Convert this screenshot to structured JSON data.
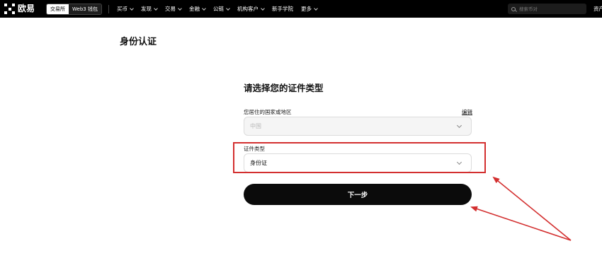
{
  "brand": {
    "name": "欧易"
  },
  "header": {
    "segments": [
      "交易所",
      "Web3 钱包"
    ],
    "nav": [
      {
        "label": "买币",
        "dropdown": true
      },
      {
        "label": "发现",
        "dropdown": true
      },
      {
        "label": "交易",
        "dropdown": true
      },
      {
        "label": "金融",
        "dropdown": true
      },
      {
        "label": "公链",
        "dropdown": true
      },
      {
        "label": "机构客户",
        "dropdown": true
      },
      {
        "label": "新手学院",
        "dropdown": false
      },
      {
        "label": "更多",
        "dropdown": true
      }
    ],
    "search_placeholder": "搜索币对",
    "right_label": "资产"
  },
  "page": {
    "title": "身份认证"
  },
  "form": {
    "title": "请选择您的证件类型",
    "country_label": "您居住的国家或地区",
    "edit_label": "编辑",
    "country_value": "中国",
    "doc_type_label": "证件类型",
    "doc_type_value": "身份证",
    "next_label": "下一步"
  },
  "colors": {
    "accent": "#000000",
    "annotation": "#d32f2f"
  }
}
